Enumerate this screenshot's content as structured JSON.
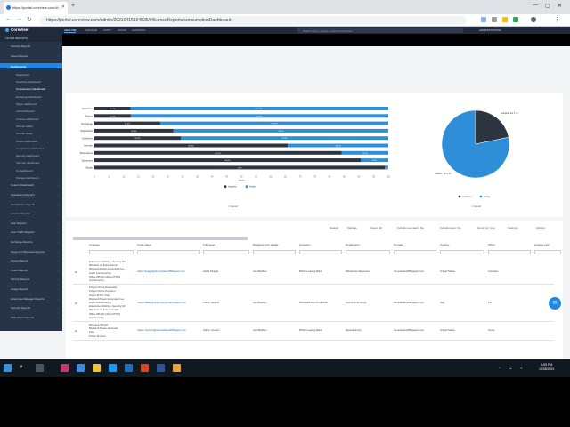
{
  "browser": {
    "tab_title": "https://portal.coreview.com/#/...",
    "url": "https://portal.coreview.com/admin/20210415194535/#/licenseReports/consumptionDashboard"
  },
  "app": {
    "logo": "CoreView",
    "nav": [
      "ANALYZE",
      "MANAGE",
      "AUDIT",
      "GROW",
      "LEARNING"
    ],
    "search_placeholder": "Search users, groups, reports and actions",
    "user": "ADMINISTRATOR"
  },
  "sidebar": {
    "filter_label": "FILTER REPORTS",
    "items": [
      {
        "label": "Favorite Reports"
      },
      {
        "label": "Saved Reports"
      },
      {
        "label": "Dashboards",
        "active": true
      },
      {
        "label": "Dashboard",
        "sub": true
      },
      {
        "label": "OneDrive dashboard",
        "sub": true
      },
      {
        "label": "Consumption Dashboard",
        "sub": true,
        "current": true
      },
      {
        "label": "Exchange dashboard",
        "sub": true
      },
      {
        "label": "Skype dashboard",
        "sub": true
      },
      {
        "label": "Intel dashboard",
        "sub": true
      },
      {
        "label": "License dashboard",
        "sub": true
      },
      {
        "label": "Service status",
        "sub": true
      },
      {
        "label": "Service usage",
        "sub": true
      },
      {
        "label": "Teams dashboard",
        "sub": true
      },
      {
        "label": "Compliance dashboard",
        "sub": true
      },
      {
        "label": "Security dashboard",
        "sub": true
      },
      {
        "label": "Yammer dashboard",
        "sub": true
      },
      {
        "label": "Vo dashboard",
        "sub": true
      },
      {
        "label": "Storage dashboard",
        "sub": true
      },
      {
        "label": "Custom Dashboard"
      },
      {
        "label": "Operational Reports"
      },
      {
        "label": "Compliance Reports"
      },
      {
        "label": "License Reports"
      },
      {
        "label": "User Reports"
      },
      {
        "label": "User Traffic Reports"
      },
      {
        "label": "Exchange Reports"
      },
      {
        "label": "Skype For Business Reports"
      },
      {
        "label": "Teams Reports"
      },
      {
        "label": "Cloud Reports"
      },
      {
        "label": "Service Reports"
      },
      {
        "label": "Usage Reports"
      },
      {
        "label": "Enterprise Manager Reports"
      },
      {
        "label": "Security Reports"
      },
      {
        "label": "SharePoint Reports"
      }
    ]
  },
  "chart_data": [
    {
      "type": "bar",
      "orientation": "horizontal",
      "stacked": true,
      "categories": [
        "OneDrive",
        "Teams",
        "Exchange",
        "SharePoint",
        "OneDrive",
        "Yammer",
        "PowerApps",
        "Dynamics",
        "Skype"
      ],
      "series": [
        {
          "name": "Active",
          "color": "#2e8fd8",
          "values": [
            87.7,
            87.6,
            77.6,
            73.1,
            70.6,
            34.2,
            15.9,
            9.4,
            1.0
          ]
        },
        {
          "name": "Inactive",
          "color": "#2c3540",
          "values": [
            12.3,
            12.4,
            22.4,
            26.9,
            29.4,
            65.8,
            84.1,
            90.6,
            99.0
          ]
        }
      ],
      "bar_labels_active": [
        "87.73%",
        "87.6%",
        "77.63%",
        "73.1%",
        "70.6%",
        "34.2%",
        "15.9%",
        "9.4%",
        "1.0%"
      ],
      "bar_labels_inactive": [
        "12.3%",
        "12.4%",
        "22.3%",
        "26.9%",
        "29.4%",
        "65.8%",
        "84.1%",
        "90.6%",
        "99%"
      ],
      "xlim": [
        0,
        100
      ],
      "xticks": [
        "0",
        "5",
        "10",
        "15",
        "20",
        "25",
        "30",
        "35",
        "40",
        "45",
        "50",
        "55",
        "60",
        "65",
        "70",
        "75",
        "80",
        "85",
        "90",
        "95",
        "100"
      ],
      "xlabel": "Values",
      "legend": [
        "Inactive",
        "Active"
      ],
      "legend_position": "bottom"
    },
    {
      "type": "pie",
      "slices": [
        {
          "name": "Inactive",
          "value": 21.7,
          "color": "#2c3540"
        },
        {
          "name": "Active",
          "value": 78.3,
          "color": "#2e8fd8"
        }
      ],
      "slice_labels": [
        "Inactive: 21.7 %",
        "Active: 78.3 %"
      ],
      "legend": [
        "Inactive",
        "Active"
      ],
      "legend_position": "bottom"
    }
  ],
  "export_label": "Export",
  "table": {
    "toolbar": [
      "Reload",
      "Manage",
      "Users: All",
      "Include new users: No",
      "Include users: No",
      "Group by: Lice",
      "Columns",
      "Actions"
    ],
    "columns": [
      "Licenses",
      "Login name",
      "Full name",
      "Recipient type details",
      "Company",
      "Department",
      "Domain",
      "Country",
      "Office",
      "License posi"
    ],
    "rows": [
      {
        "licenses": [
          "Enterprise Mobility + Security E3",
          "Windows 10 Enterprise E3",
          "Microsoft Power Automate Free",
          "Audio Conferencing",
          "Office 365 E5 without PSTN",
          "Conferencing"
        ],
        "login": "Abdul.Swagel@demoshared365apac2.com",
        "name": "Abdul Swagel",
        "type": "UserMailbox",
        "company": "British Leasing Bank",
        "department": "HR/Human Resources",
        "domain": "demoshared365apac2.com",
        "country": "United States",
        "office": "Colorado"
      },
      {
        "licenses": [
          "Project Online Essentials",
          "Project Online Premium",
          "Power BI Pro Trial",
          "Microsoft Power Automate Free",
          "Audio Conferencing",
          "Enterprise Mobility + Security E3",
          "Windows 10 Enterprise E3",
          "Office 365 E5 without PSTN",
          "Conferencing"
        ],
        "login": "Adrien.Hawind@demoshared365apac2.com",
        "name": "Adrien Hawind",
        "type": "UserMailbox",
        "company": "Overseas Gas Production",
        "department": "Technical Services",
        "domain": "demoshared365apac2.com",
        "country": "Italy",
        "office": "FR"
      },
      {
        "licenses": [
          "Microsoft 365 E3",
          "Microsoft Power Automate",
          "Free",
          "Power BI (free)"
        ],
        "login": "Adrien.Smeriel@demoshared365apac2.com",
        "name": "Adrien Smeriel",
        "type": "UserMailbox",
        "company": "British Leasing Bank",
        "department": "Manufacturing",
        "domain": "demoshared365apac2.com",
        "country": "United States",
        "office": "Texas"
      }
    ]
  },
  "taskbar": {
    "time": "1:55 PM",
    "date": "10/08/2021"
  }
}
